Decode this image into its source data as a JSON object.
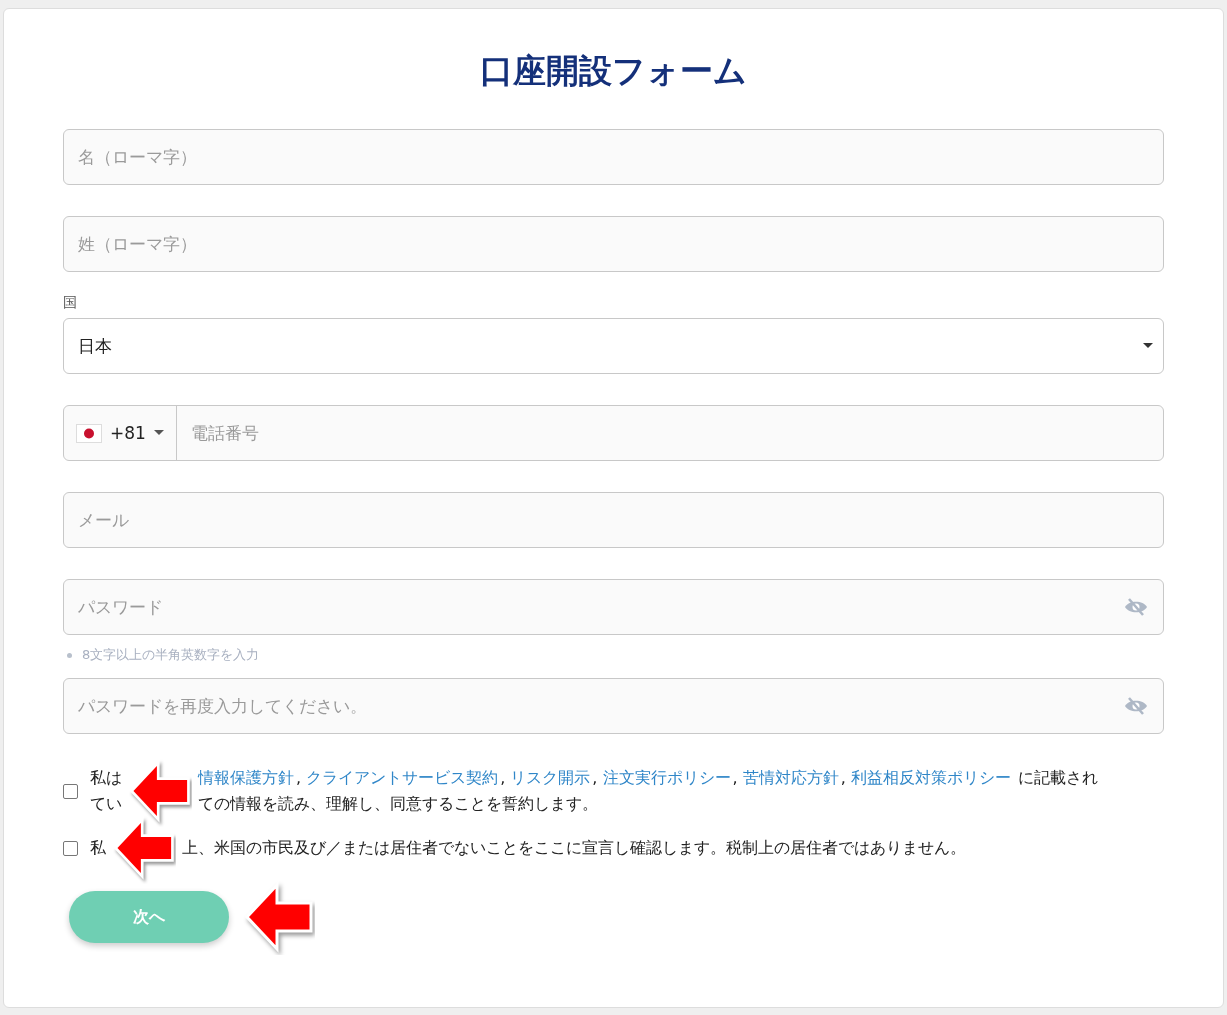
{
  "title": "口座開設フォーム",
  "fields": [
    {
      "kind": "text",
      "placeholder": "名（ローマ字）"
    },
    {
      "kind": "text",
      "placeholder": "姓（ローマ字）"
    },
    {
      "kind": "select",
      "label": "国",
      "value": "日本"
    },
    {
      "kind": "phone",
      "code": "+81",
      "placeholder": "電話番号"
    },
    {
      "kind": "text",
      "placeholder": "メール"
    },
    {
      "kind": "password",
      "placeholder": "パスワード",
      "hint": "8文字以上の半角英数字を入力"
    },
    {
      "kind": "password",
      "placeholder": "パスワードを再度入力してください。"
    }
  ],
  "consents": [
    {
      "checked": false,
      "arrow": true,
      "prefixes": [
        "私は",
        "てい"
      ],
      "lines": [
        [
          {
            "kind": "link",
            "text": "情報保護方針",
            "separator": ","
          },
          {
            "kind": "link",
            "text": "クライアントサービス契約",
            "separator": ","
          },
          {
            "kind": "link",
            "text": "リスク開示",
            "separator": ","
          },
          {
            "kind": "link",
            "text": "注文実行ポリシー",
            "separator": ","
          },
          {
            "kind": "link",
            "text": "苦情対応方針",
            "separator": ","
          },
          {
            "kind": "link",
            "text": "利益相反対策ポリシー"
          },
          {
            "kind": "text",
            "text": " に記載され"
          }
        ],
        [
          {
            "kind": "text",
            "text": "ての情報を読み、理解し、同意することを誓約します。"
          }
        ]
      ]
    },
    {
      "checked": false,
      "arrow": true,
      "prefixes": [
        "私"
      ],
      "lines": [
        [
          {
            "kind": "text",
            "text": "上、米国の市民及び／または居住者でないことをここに宣言し確認します。税制上の居住者ではありません。"
          }
        ]
      ]
    }
  ],
  "next_button": {
    "label": "次へ",
    "arrow": true
  }
}
